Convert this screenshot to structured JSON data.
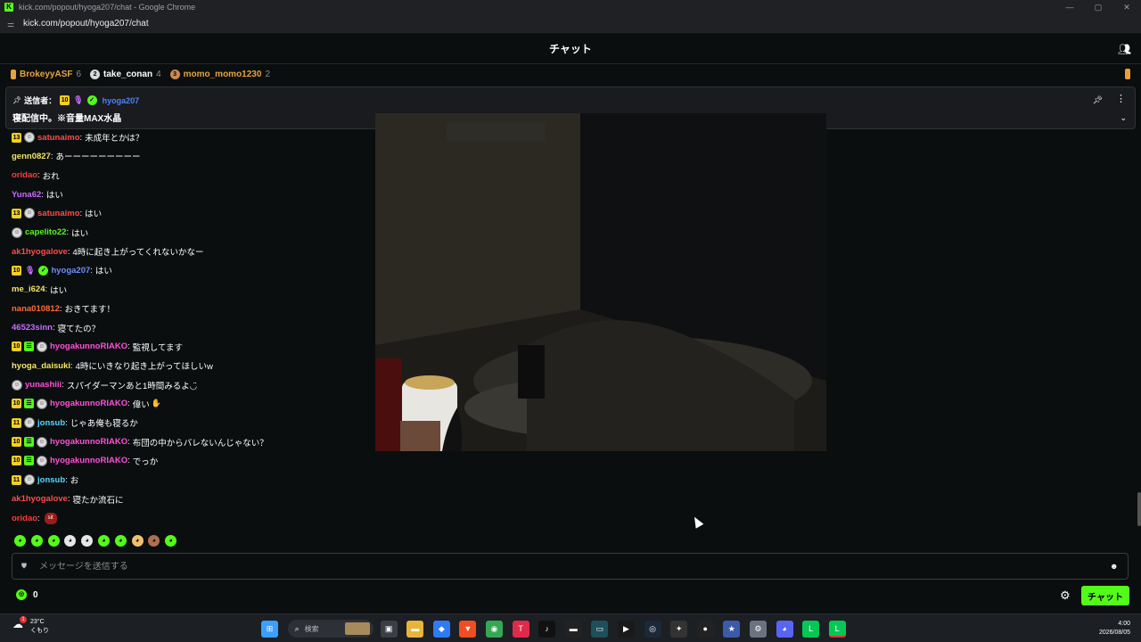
{
  "window": {
    "title": "kick.com/popout/hyoga207/chat - Google Chrome",
    "url": "kick.com/popout/hyoga207/chat",
    "controls": [
      "—",
      "▢",
      "✕"
    ]
  },
  "header": {
    "title": "チャット"
  },
  "leaderboard": [
    {
      "rank": "",
      "name": "BrokeyyASF",
      "count": "6",
      "color": "#e8a23b",
      "rank_color": "#e8a23b"
    },
    {
      "rank": "2",
      "name": "take_conan",
      "count": "4",
      "color": "#ffffff",
      "rank_color": "#d9d9d9"
    },
    {
      "rank": "3",
      "name": "momo_momo1230",
      "count": "2",
      "color": "#e8a23b",
      "rank_color": "#c98a54"
    }
  ],
  "pinned": {
    "sender_label": "送信者：",
    "badge": "10",
    "user": "hyoga207",
    "message": "寝配信中。※音量MAX水晶"
  },
  "messages": [
    {
      "badges": [
        "13",
        "avatar"
      ],
      "user": "satunaimo",
      "color": "#ff4b4b",
      "text": "未成年とかは？"
    },
    {
      "badges": [],
      "user": "genn0827",
      "color": "#f5e663",
      "text": "あーーーーーーーーー"
    },
    {
      "badges": [],
      "user": "oridao",
      "color": "#ff3b3b",
      "text": "おれ"
    },
    {
      "badges": [],
      "user": "Yuna62",
      "color": "#c96cff",
      "text": "はい"
    },
    {
      "badges": [
        "13",
        "avatar"
      ],
      "user": "satunaimo",
      "color": "#ff4b4b",
      "text": "はい"
    },
    {
      "badges": [
        "avatar"
      ],
      "user": "capelito22",
      "color": "#53fc18",
      "text": "はい"
    },
    {
      "badges": [],
      "user": "ak1hyogalove",
      "color": "#ff4b4b",
      "text": "4時に起き上がってくれないかなー"
    },
    {
      "badges": [
        "10",
        "mic",
        "verified"
      ],
      "user": "hyoga207",
      "color": "#6f8dff",
      "text": "はい"
    },
    {
      "badges": [],
      "user": "me_i624",
      "color": "#f5e663",
      "text": "はい"
    },
    {
      "badges": [],
      "user": "nana010812",
      "color": "#ff6a3d",
      "text": "おきてます！"
    },
    {
      "badges": [],
      "user": "46523sinn",
      "color": "#c96cff",
      "text": "寝てたの？"
    },
    {
      "badges": [
        "10",
        "green",
        "avatar"
      ],
      "user": "hyogakunnoRIAKO",
      "color": "#ff4fd8",
      "text": "監視してます"
    },
    {
      "badges": [],
      "user": "hyoga_daisuki",
      "color": "#f5e663",
      "text": "4時にいきなり起き上がってほしいw"
    },
    {
      "badges": [
        "avatar"
      ],
      "user": "yunashiii",
      "color": "#ff4fd8",
      "text": "スパイダーマンあと1時間みるよ◡̈"
    },
    {
      "badges": [
        "10",
        "green",
        "avatar"
      ],
      "user": "hyogakunnoRIAKO",
      "color": "#ff4fd8",
      "text": "偉い",
      "emote": "hand"
    },
    {
      "badges": [
        "11",
        "avatar"
      ],
      "user": "jonsub",
      "color": "#53d8ff",
      "text": "じゃあ俺も寝るか"
    },
    {
      "badges": [
        "10",
        "green",
        "avatar"
      ],
      "user": "hyogakunnoRIAKO",
      "color": "#ff4fd8",
      "text": "布団の中からバレないんじゃない？"
    },
    {
      "badges": [
        "10",
        "green",
        "avatar"
      ],
      "user": "hyogakunnoRIAKO",
      "color": "#ff4fd8",
      "text": "でっか"
    },
    {
      "badges": [
        "11",
        "avatar"
      ],
      "user": "jonsub",
      "color": "#53d8ff",
      "text": "お"
    },
    {
      "badges": [],
      "user": "ak1hyogalove",
      "color": "#ff4b4b",
      "text": "寝たか流石に"
    },
    {
      "badges": [],
      "user": "oridao",
      "color": "#ff3b3b",
      "text": "",
      "emote": "sit",
      "emote_label": "sit"
    }
  ],
  "emote_bar": [
    "#53fc18",
    "#53fc18",
    "#53fc18",
    "#e6e6e6",
    "#e6e6e6",
    "#53fc18",
    "#53fc18",
    "#f0c070",
    "#b07050",
    "#53fc18"
  ],
  "input": {
    "placeholder": "メッセージを送信する"
  },
  "bottom": {
    "points": "0",
    "send_label": "チャット"
  },
  "taskbar": {
    "temp": "23°C",
    "weather": "くもり",
    "weather_badge": "1",
    "search_label": "検索",
    "time": "4:00",
    "date": "2026/08/05",
    "icons": [
      {
        "name": "windows-start-icon",
        "color": "#3aa0ff",
        "glyph": "⊞"
      },
      {
        "name": "taskview-icon",
        "color": "#3b3f45",
        "glyph": "▣"
      },
      {
        "name": "file-explorer-icon",
        "color": "#e8b53a",
        "glyph": "▬"
      },
      {
        "name": "app-blue-icon",
        "color": "#2f7bf5",
        "glyph": "◆"
      },
      {
        "name": "brave-icon",
        "color": "#f04d23",
        "glyph": "▼"
      },
      {
        "name": "chrome-icon",
        "color": "#34a853",
        "glyph": "◉"
      },
      {
        "name": "app-red-icon",
        "color": "#e02a4a",
        "glyph": "T"
      },
      {
        "name": "tiktok-icon",
        "color": "#111111",
        "glyph": "♪"
      },
      {
        "name": "app-dark-icon",
        "color": "#222222",
        "glyph": "▬"
      },
      {
        "name": "app-teal-icon",
        "color": "#1f4f5a",
        "glyph": "▭"
      },
      {
        "name": "app-green-play-icon",
        "color": "#1a1a1a",
        "glyph": "▶"
      },
      {
        "name": "steam-icon",
        "color": "#1b2838",
        "glyph": "◎"
      },
      {
        "name": "app-multicolor-icon",
        "color": "#333333",
        "glyph": "✦"
      },
      {
        "name": "obs-icon",
        "color": "#222222",
        "glyph": "●"
      },
      {
        "name": "app-star-icon",
        "color": "#3b5ba9",
        "glyph": "★"
      },
      {
        "name": "settings-gear-icon",
        "color": "#6b7280",
        "glyph": "⚙"
      },
      {
        "name": "discord-icon",
        "color": "#5865f2",
        "glyph": "◕"
      },
      {
        "name": "line-icon",
        "color": "#06c755",
        "glyph": "L"
      },
      {
        "name": "line-active-icon",
        "color": "#06c755",
        "glyph": "L"
      }
    ]
  }
}
